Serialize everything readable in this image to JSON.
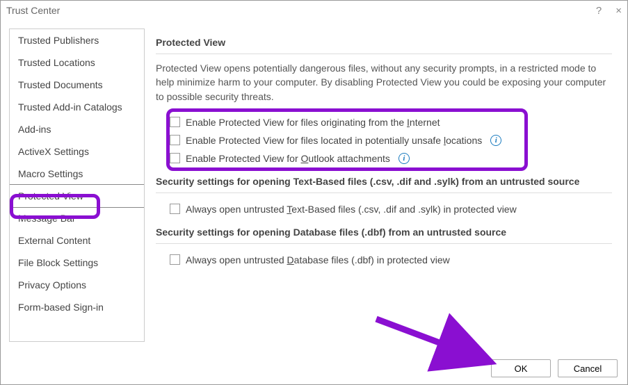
{
  "window": {
    "title": "Trust Center",
    "help": "?",
    "close": "×"
  },
  "sidebar": {
    "items": [
      {
        "label": "Trusted Publishers"
      },
      {
        "label": "Trusted Locations"
      },
      {
        "label": "Trusted Documents"
      },
      {
        "label": "Trusted Add-in Catalogs"
      },
      {
        "label": "Add-ins"
      },
      {
        "label": "ActiveX Settings"
      },
      {
        "label": "Macro Settings"
      },
      {
        "label": "Protected View",
        "selected": true
      },
      {
        "label": "Message Bar"
      },
      {
        "label": "External Content"
      },
      {
        "label": "File Block Settings"
      },
      {
        "label": "Privacy Options"
      },
      {
        "label": "Form-based Sign-in"
      }
    ]
  },
  "main": {
    "pv_header": "Protected View",
    "pv_desc": "Protected View opens potentially dangerous files, without any security prompts, in a restricted mode to help minimize harm to your computer. By disabling Protected View you could be exposing your computer to possible security threats.",
    "cb1_pre": "Enable Protected View for files originating from the ",
    "cb1_u": "I",
    "cb1_post": "nternet",
    "cb2_pre": "Enable Protected View for files located in potentially unsafe ",
    "cb2_u": "l",
    "cb2_post": "ocations",
    "cb3_pre": "Enable Protected View for ",
    "cb3_u": "O",
    "cb3_post": "utlook attachments",
    "text_header": "Security settings for opening Text-Based files (.csv, .dif and .sylk) from an untrusted source",
    "cb4_pre": "Always open untrusted ",
    "cb4_u": "T",
    "cb4_post": "ext-Based files (.csv, .dif and .sylk) in protected view",
    "db_header": "Security settings for opening Database files (.dbf) from an untrusted source",
    "cb5_pre": "Always open untrusted ",
    "cb5_u": "D",
    "cb5_post": "atabase files (.dbf) in protected view",
    "info_glyph": "i"
  },
  "buttons": {
    "ok": "OK",
    "cancel": "Cancel"
  }
}
